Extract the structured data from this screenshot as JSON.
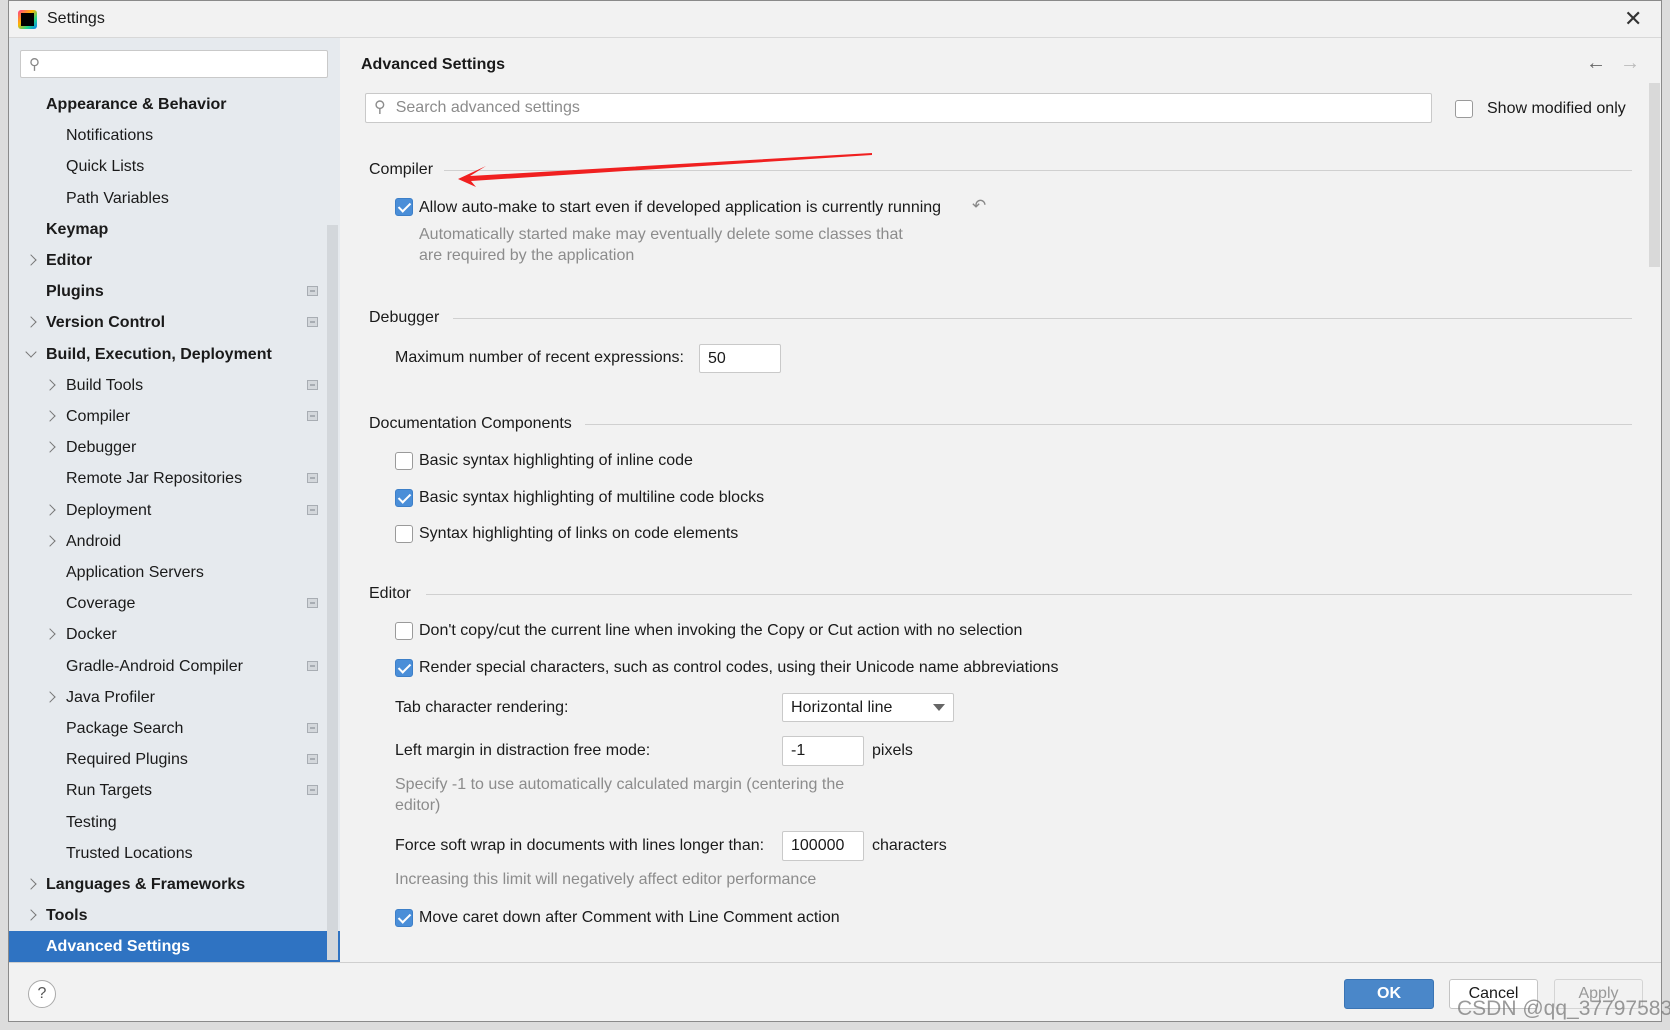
{
  "window": {
    "title": "Settings"
  },
  "sidebar": {
    "search_placeholder": "",
    "items": [
      {
        "label": "Appearance & Behavior",
        "level": 0,
        "expandable": false,
        "badge": false
      },
      {
        "label": "Notifications",
        "level": 1,
        "expandable": false,
        "badge": false
      },
      {
        "label": "Quick Lists",
        "level": 1,
        "expandable": false,
        "badge": false
      },
      {
        "label": "Path Variables",
        "level": 1,
        "expandable": false,
        "badge": false
      },
      {
        "label": "Keymap",
        "level": 0,
        "expandable": false,
        "badge": false
      },
      {
        "label": "Editor",
        "level": 0,
        "expandable": true,
        "badge": false
      },
      {
        "label": "Plugins",
        "level": 0,
        "expandable": false,
        "badge": true
      },
      {
        "label": "Version Control",
        "level": 0,
        "expandable": true,
        "badge": true
      },
      {
        "label": "Build, Execution, Deployment",
        "level": 0,
        "expandable": true,
        "expanded": true,
        "badge": false
      },
      {
        "label": "Build Tools",
        "level": 1,
        "expandable": true,
        "badge": true
      },
      {
        "label": "Compiler",
        "level": 1,
        "expandable": true,
        "badge": true
      },
      {
        "label": "Debugger",
        "level": 1,
        "expandable": true,
        "badge": false
      },
      {
        "label": "Remote Jar Repositories",
        "level": 1,
        "expandable": false,
        "badge": true
      },
      {
        "label": "Deployment",
        "level": 1,
        "expandable": true,
        "badge": true
      },
      {
        "label": "Android",
        "level": 1,
        "expandable": true,
        "badge": false
      },
      {
        "label": "Application Servers",
        "level": 1,
        "expandable": false,
        "badge": false
      },
      {
        "label": "Coverage",
        "level": 1,
        "expandable": false,
        "badge": true
      },
      {
        "label": "Docker",
        "level": 1,
        "expandable": true,
        "badge": false
      },
      {
        "label": "Gradle-Android Compiler",
        "level": 1,
        "expandable": false,
        "badge": true
      },
      {
        "label": "Java Profiler",
        "level": 1,
        "expandable": true,
        "badge": false
      },
      {
        "label": "Package Search",
        "level": 1,
        "expandable": false,
        "badge": true
      },
      {
        "label": "Required Plugins",
        "level": 1,
        "expandable": false,
        "badge": true
      },
      {
        "label": "Run Targets",
        "level": 1,
        "expandable": false,
        "badge": true
      },
      {
        "label": "Testing",
        "level": 1,
        "expandable": false,
        "badge": false
      },
      {
        "label": "Trusted Locations",
        "level": 1,
        "expandable": false,
        "badge": false
      },
      {
        "label": "Languages & Frameworks",
        "level": 0,
        "expandable": true,
        "badge": false
      },
      {
        "label": "Tools",
        "level": 0,
        "expandable": true,
        "badge": false
      },
      {
        "label": "Advanced Settings",
        "level": 0,
        "expandable": false,
        "badge": false,
        "selected": true
      }
    ]
  },
  "main": {
    "title": "Advanced Settings",
    "search_placeholder": "Search advanced settings",
    "show_modified_label": "Show modified only",
    "show_modified_checked": false,
    "compiler": {
      "header": "Compiler",
      "auto_make_label": "Allow auto-make to start even if developed application is currently running",
      "auto_make_checked": true,
      "desc1": "Automatically started make may eventually delete some classes that",
      "desc2": "are required by the application"
    },
    "debugger": {
      "header": "Debugger",
      "max_expr_label": "Maximum number of recent expressions:",
      "max_expr_value": "50"
    },
    "doc": {
      "header": "Documentation Components",
      "items": [
        {
          "label": "Basic syntax highlighting of inline code",
          "checked": false
        },
        {
          "label": "Basic syntax highlighting of multiline code blocks",
          "checked": true
        },
        {
          "label": "Syntax highlighting of links on code elements",
          "checked": false
        }
      ]
    },
    "editor": {
      "header": "Editor",
      "no_copy_label": "Don't copy/cut the current line when invoking the Copy or Cut action with no selection",
      "no_copy_checked": false,
      "render_label": "Render special characters, such as control codes, using their Unicode name abbreviations",
      "render_checked": true,
      "tab_label": "Tab character rendering:",
      "tab_value": "Horizontal line",
      "margin_label": "Left margin in distraction free mode:",
      "margin_value": "-1",
      "margin_unit": "pixels",
      "margin_desc1": "Specify -1 to use automatically calculated margin (centering the",
      "margin_desc2": "editor)",
      "wrap_label": "Force soft wrap in documents with lines longer than:",
      "wrap_value": "100000",
      "wrap_unit": "characters",
      "wrap_desc": "Increasing this limit will negatively affect editor performance",
      "caret_label": "Move caret down after Comment with Line Comment action",
      "caret_checked": true
    }
  },
  "footer": {
    "help": "?",
    "ok": "OK",
    "cancel": "Cancel",
    "apply": "Apply"
  },
  "watermark": "CSDN @qq_37797583",
  "colors": {
    "accent": "#2f73c2",
    "ok_button": "#4a87c9",
    "annotation_arrow": "#f02020"
  }
}
